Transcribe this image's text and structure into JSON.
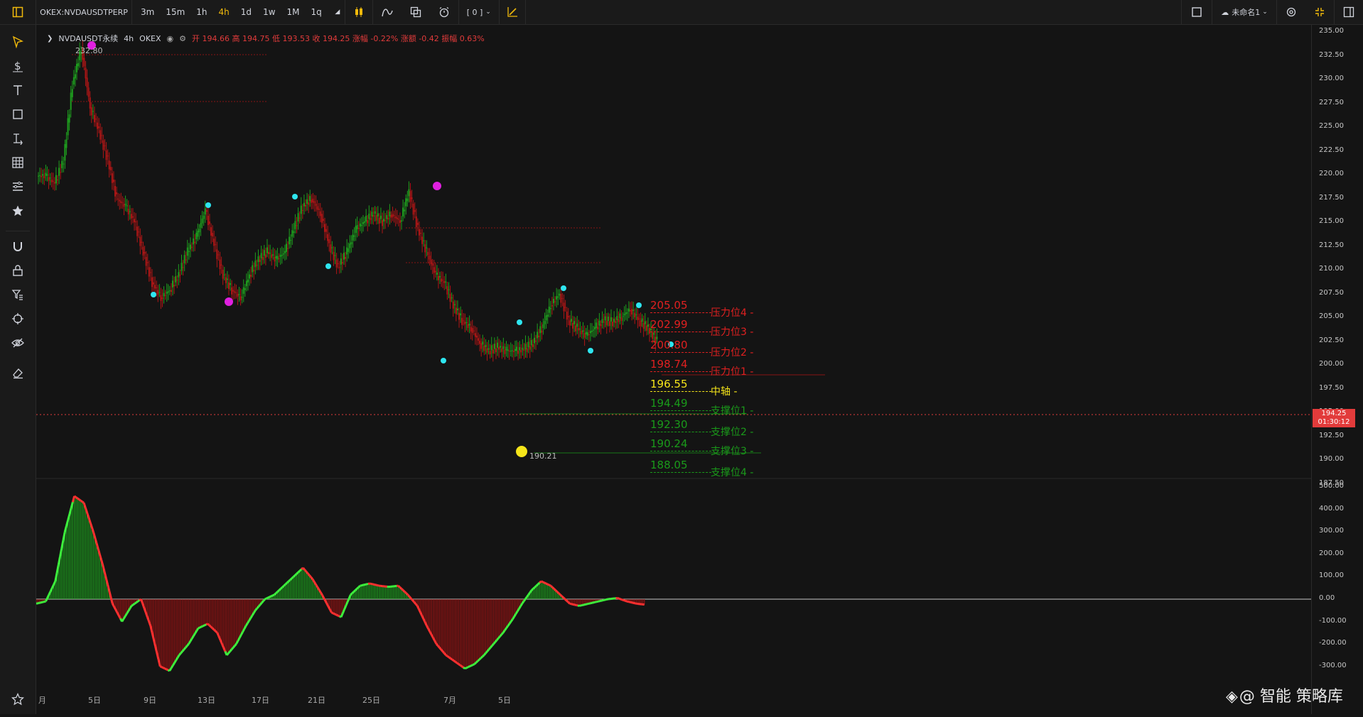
{
  "topbar": {
    "symbol": "OKEX:NVDAUSDTPERP",
    "timeframes": [
      "3m",
      "15m",
      "1h",
      "4h",
      "1d",
      "1w",
      "1M",
      "1q"
    ],
    "active_timeframe": "4h",
    "indicator_count": "[ 0 ]",
    "layout_name": "未命名1"
  },
  "legend": {
    "symbol": "NVDAUSDT永续",
    "interval": "4h",
    "exchange": "OKEX",
    "ohlc": "开 194.66  高 194.75  低 193.53  收 194.25  涨幅 -0.22%  涨额 -0.42  振幅 0.63%"
  },
  "levels": [
    {
      "price": "205.05",
      "name": "压力位4 -",
      "color": "#e02020",
      "kind": "resistance"
    },
    {
      "price": "202.99",
      "name": "压力位3 -",
      "color": "#e02020",
      "kind": "resistance"
    },
    {
      "price": "200.80",
      "name": "压力位2 -",
      "color": "#e02020",
      "kind": "resistance"
    },
    {
      "price": "198.74",
      "name": "压力位1 -",
      "color": "#e02020",
      "kind": "resistance"
    },
    {
      "price": "196.55",
      "name": "中轴 -",
      "color": "#f5e51a",
      "kind": "pivot"
    },
    {
      "price": "194.49",
      "name": "支撑位1 -",
      "color": "#1a9a1a",
      "kind": "support"
    },
    {
      "price": "192.30",
      "name": "支撑位2 -",
      "color": "#1a9a1a",
      "kind": "support"
    },
    {
      "price": "190.24",
      "name": "支撑位3 -",
      "color": "#1a9a1a",
      "kind": "support"
    },
    {
      "price": "188.05",
      "name": "支撑位4 -",
      "color": "#1a9a1a",
      "kind": "support"
    }
  ],
  "annotations": {
    "high": "232.80",
    "low": "190.21"
  },
  "price_axis": {
    "main": [
      "235.00",
      "232.50",
      "230.00",
      "227.50",
      "225.00",
      "222.50",
      "220.00",
      "217.50",
      "215.00",
      "212.50",
      "210.00",
      "207.50",
      "205.00",
      "202.50",
      "200.00",
      "197.50",
      "195.00",
      "192.50",
      "190.00",
      "187.50"
    ],
    "indicator": [
      "500.00",
      "400.00",
      "300.00",
      "200.00",
      "100.00",
      "0.00",
      "-100.00",
      "-200.00",
      "-300.00"
    ],
    "last_price": "194.25",
    "countdown": "01:30:12"
  },
  "time_axis": [
    "月",
    "5日",
    "9日",
    "13日",
    "17日",
    "21日",
    "25日",
    "7月",
    "5日"
  ],
  "watermark": "@ 智能 策略库",
  "colors": {
    "up": "#1e9e1e",
    "down": "#b01616",
    "accent": "#f0b90b",
    "bg": "#141414",
    "cyan": "#2ee6f0",
    "magenta": "#e020e0"
  },
  "chart_data": {
    "type": "line",
    "title": "",
    "series": [
      {
        "values": [
          216,
          215,
          218,
          228,
          232.8,
          225,
          222,
          218,
          213,
          212,
          210,
          206,
          202,
          200,
          201,
          203,
          206,
          208,
          211.5,
          207,
          203,
          201,
          200,
          203,
          205,
          206,
          205,
          206,
          209,
          212,
          213,
          211,
          207,
          204,
          206,
          209,
          210,
          211,
          210,
          211,
          210,
          214,
          209,
          206,
          203,
          202,
          199,
          197,
          196,
          194,
          193,
          193.5,
          193,
          193,
          193.2,
          194,
          196,
          199,
          200.5,
          197,
          196,
          195,
          196,
          197,
          196.8,
          197.5,
          198.5,
          197,
          196,
          194.25
        ]
      }
    ]
  }
}
